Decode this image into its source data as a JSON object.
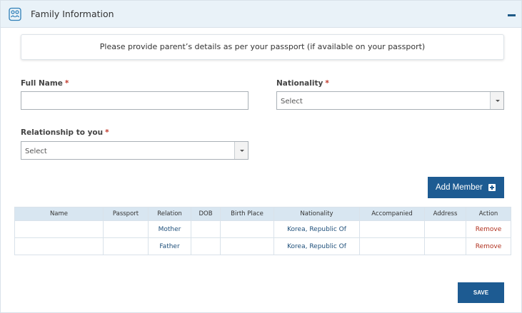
{
  "header": {
    "title": "Family Information",
    "icon": "family-icon",
    "collapse_icon": "minus-icon"
  },
  "notice": "Please provide parent’s details as per your passport (if available on your passport)",
  "form": {
    "full_name": {
      "label": "Full Name",
      "required_mark": "*",
      "value": ""
    },
    "nationality": {
      "label": "Nationality",
      "required_mark": "*",
      "value": "Select"
    },
    "relationship": {
      "label": "Relationship to you",
      "required_mark": "*",
      "value": "Select"
    }
  },
  "add_member_label": "Add Member",
  "table": {
    "columns": [
      "Name",
      "Passport",
      "Relation",
      "DOB",
      "Birth Place",
      "Nationality",
      "Accompanied",
      "Address",
      "Action"
    ],
    "rows": [
      {
        "name": "",
        "passport": "",
        "relation": "Mother",
        "dob": "",
        "birth_place": "",
        "nationality": "Korea, Republic Of",
        "accompanied": "",
        "address": "",
        "action": "Remove"
      },
      {
        "name": "",
        "passport": "",
        "relation": "Father",
        "dob": "",
        "birth_place": "",
        "nationality": "Korea, Republic Of",
        "accompanied": "",
        "address": "",
        "action": "Remove"
      }
    ]
  },
  "save_label": "SAVE",
  "colors": {
    "primary": "#1d5b92",
    "header_bg": "#e9f2f8",
    "table_header_bg": "#d8e6f1",
    "required": "#c0392b",
    "remove": "#b0301e"
  }
}
